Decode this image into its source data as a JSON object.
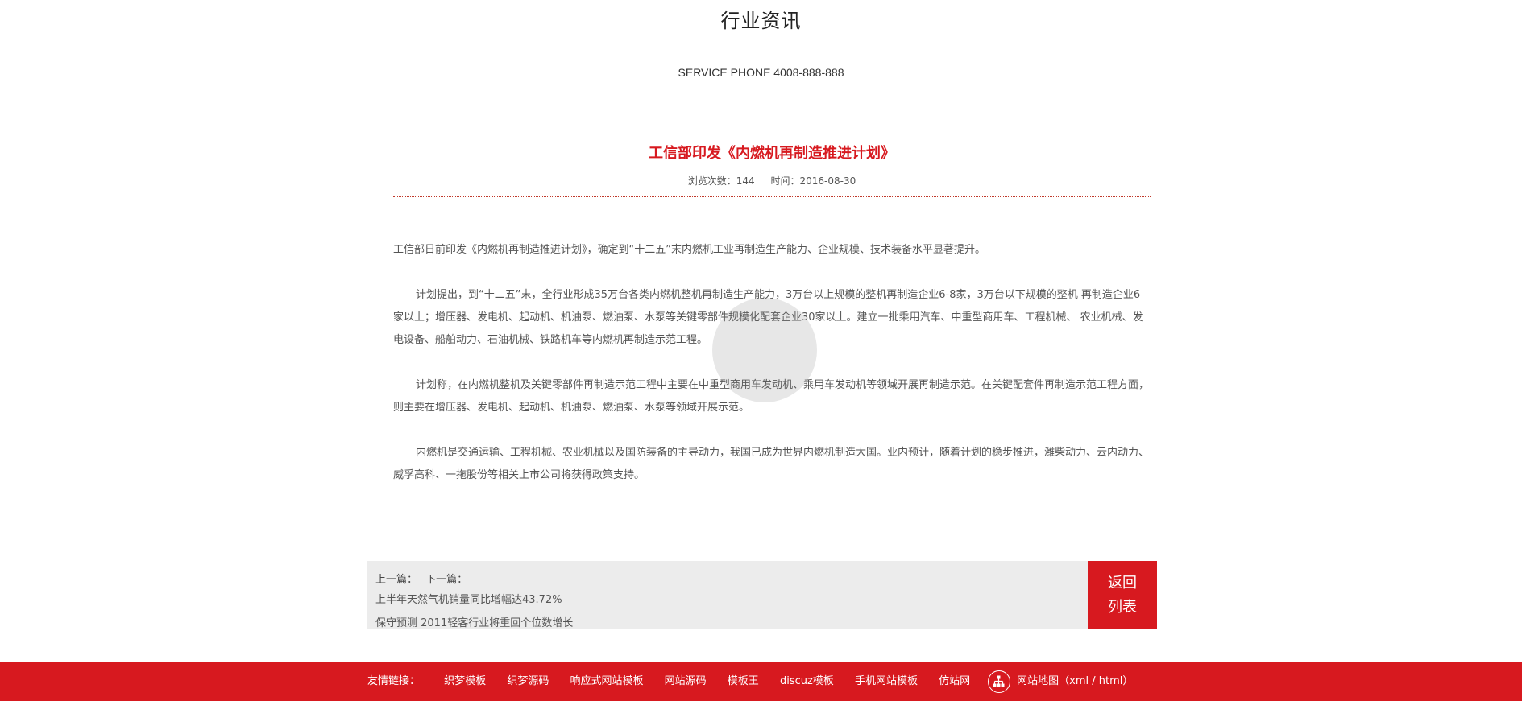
{
  "header": {
    "section_title": "行业资讯",
    "service_phone": "SERVICE PHONE 4008-888-888"
  },
  "article": {
    "title": "工信部印发《内燃机再制造推进计划》",
    "views_label": "浏览次数：144",
    "time_label": "时间：2016-08-30",
    "paragraphs": [
      "工信部日前印发《内燃机再制造推进计划》，确定到“十二五”末内燃机工业再制造生产能力、企业规模、技术装备水平显著提升。",
      "计划提出，到“十二五”末，全行业形成35万台各类内燃机整机再制造生产能力，3万台以上规模的整机再制造企业6-8家，3万台以下规模的整机 再制造企业6家以上；增压器、发电机、起动机、机油泵、燃油泵、水泵等关键零部件规模化配套企业30家以上。建立一批乘用汽车、中重型商用车、工程机械、 农业机械、发电设备、船舶动力、石油机械、铁路机车等内燃机再制造示范工程。",
      "计划称，在内燃机整机及关键零部件再制造示范工程中主要在中重型商用车发动机、乘用车发动机等领域开展再制造示范。在关键配套件再制造示范工程方面，则主要在增压器、发电机、起动机、机油泵、燃油泵、水泵等领域开展示范。",
      "内燃机是交通运输、工程机械、农业机械以及国防装备的主导动力，我国已成为世界内燃机制造大国。业内预计，随着计划的稳步推进，潍柴动力、云内动力、威孚高科、一拖股份等相关上市公司将获得政策支持。"
    ]
  },
  "prev_next": {
    "prev_label": "上一篇：",
    "next_label": "下一篇：",
    "link_1": "上半年天然气机销量同比增幅达43.72%",
    "link_2": "保守预测 2011轻客行业将重回个位数增长"
  },
  "back_button": {
    "line_1": "返回",
    "line_2": "列表"
  },
  "footer": {
    "links_label": "友情链接：",
    "links": [
      "织梦模板",
      "织梦源码",
      "响应式网站模板",
      "网站源码",
      "模板王",
      "discuz模板",
      "手机网站模板",
      "仿站网"
    ],
    "sitemap_label": "网站地图（xml / html）"
  },
  "colors": {
    "accent": "#d7191f",
    "prev_next_bg": "#ececec"
  }
}
